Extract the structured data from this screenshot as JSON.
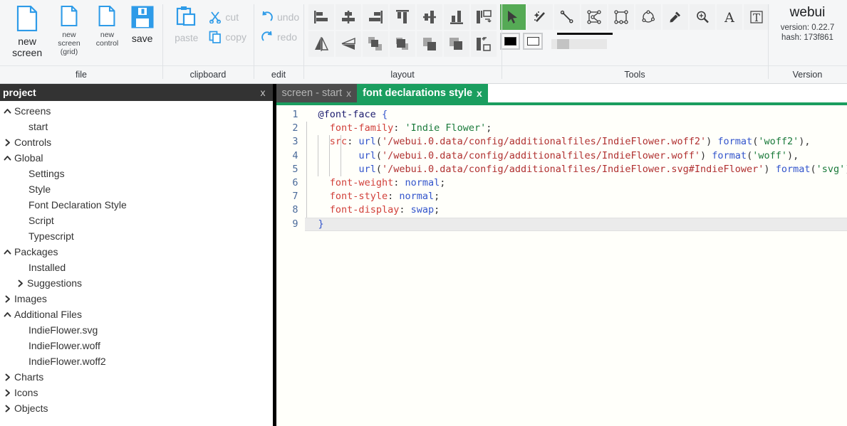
{
  "ribbon": {
    "groups": [
      {
        "label": "file",
        "items": [
          {
            "name": "new-screen",
            "label": "new screen",
            "icon": "document-icon"
          },
          {
            "name": "new-screen-grid",
            "label": "new screen\n(grid)",
            "label_line1": "new screen",
            "label_line2": "(grid)",
            "icon": "document-icon"
          },
          {
            "name": "new-control",
            "label": "new control",
            "icon": "document-icon"
          },
          {
            "name": "save",
            "label": "save",
            "icon": "floppy-disk-icon"
          }
        ]
      },
      {
        "label": "clipboard",
        "items": [
          {
            "name": "paste",
            "label": "paste",
            "icon": "clipboard-icon",
            "disabled": true
          },
          {
            "name": "cut",
            "label": "cut",
            "icon": "scissors-icon",
            "disabled": true
          },
          {
            "name": "copy",
            "label": "copy",
            "icon": "copy-icon",
            "disabled": true
          }
        ]
      },
      {
        "label": "edit",
        "items": [
          {
            "name": "undo",
            "label": "undo",
            "icon": "undo-arrow-icon",
            "disabled": true
          },
          {
            "name": "redo",
            "label": "redo",
            "icon": "redo-arrow-icon",
            "disabled": true
          }
        ]
      },
      {
        "label": "layout",
        "items": [
          {
            "name": "align-left",
            "icon": "align-left-icon"
          },
          {
            "name": "align-center-horizontal",
            "icon": "align-center-horizontal-icon"
          },
          {
            "name": "align-right",
            "icon": "align-right-icon"
          },
          {
            "name": "align-top",
            "icon": "align-top-icon"
          },
          {
            "name": "align-center-vertical",
            "icon": "align-center-vertical-icon"
          },
          {
            "name": "align-bottom",
            "icon": "align-bottom-icon"
          },
          {
            "name": "distribute-horizontal",
            "icon": "distribute-horizontal-icon"
          },
          {
            "name": "flip-horizontal",
            "icon": "flip-horizontal-icon"
          },
          {
            "name": "flip-vertical",
            "icon": "flip-vertical-icon"
          },
          {
            "name": "send-to-back",
            "icon": "send-to-back-icon"
          },
          {
            "name": "send-backward",
            "icon": "send-backward-icon"
          },
          {
            "name": "bring-forward",
            "icon": "bring-forward-icon"
          },
          {
            "name": "bring-to-front",
            "icon": "bring-to-front-icon"
          },
          {
            "name": "distribute-vertical",
            "icon": "distribute-vertical-icon"
          }
        ]
      },
      {
        "label": "Tools",
        "items": [
          {
            "name": "select-tool",
            "icon": "cursor-arrow-icon",
            "active": true
          },
          {
            "name": "magic-wand-tool",
            "icon": "magic-wand-icon"
          },
          {
            "name": "line-tool",
            "icon": "line-icon"
          },
          {
            "name": "polygon-tool",
            "icon": "polygon-icon"
          },
          {
            "name": "rectangle-tool",
            "icon": "rectangle-icon"
          },
          {
            "name": "ellipse-tool",
            "icon": "ellipse-icon"
          },
          {
            "name": "eyedropper-tool",
            "icon": "eyedropper-icon"
          },
          {
            "name": "zoom-tool",
            "icon": "magnifier-plus-icon"
          },
          {
            "name": "text-tool",
            "icon": "letter-a-icon"
          },
          {
            "name": "textbox-tool",
            "icon": "letter-t-box-icon"
          }
        ],
        "options": [
          {
            "name": "fill-color-swatch",
            "icon": "filled-square-icon",
            "color": "#000000"
          },
          {
            "name": "stroke-color-swatch",
            "icon": "outlined-square-icon",
            "color": "#ffffff"
          },
          {
            "name": "stroke-width-slider",
            "icon": "slider-icon"
          }
        ]
      },
      {
        "label": "Version",
        "app_name": "webui",
        "version_line": "version: 0.22.7",
        "hash_line": "hash: 173f861"
      }
    ]
  },
  "sidebar": {
    "header": {
      "title": "project",
      "close_label": "x"
    },
    "tree": [
      {
        "label": "Screens",
        "level": 0,
        "state": "expanded",
        "icon": "chevron-up-icon"
      },
      {
        "label": "start",
        "level": 1,
        "state": "leaf",
        "icon": ""
      },
      {
        "label": "Controls",
        "level": 0,
        "state": "collapsed",
        "icon": "chevron-right-icon"
      },
      {
        "label": "Global",
        "level": 0,
        "state": "expanded",
        "icon": "chevron-up-icon"
      },
      {
        "label": "Settings",
        "level": 1,
        "state": "leaf",
        "icon": ""
      },
      {
        "label": "Style",
        "level": 1,
        "state": "leaf",
        "icon": ""
      },
      {
        "label": "Font Declaration Style",
        "level": 1,
        "state": "leaf",
        "icon": ""
      },
      {
        "label": "Script",
        "level": 1,
        "state": "leaf",
        "icon": ""
      },
      {
        "label": "Typescript",
        "level": 1,
        "state": "leaf",
        "icon": ""
      },
      {
        "label": "Packages",
        "level": 0,
        "state": "expanded",
        "icon": "chevron-up-icon"
      },
      {
        "label": "Installed",
        "level": 1,
        "state": "leaf",
        "icon": ""
      },
      {
        "label": "Suggestions",
        "level": 1,
        "state": "collapsed",
        "icon": "chevron-right-icon"
      },
      {
        "label": "Images",
        "level": 0,
        "state": "collapsed",
        "icon": "chevron-right-icon"
      },
      {
        "label": "Additional Files",
        "level": 0,
        "state": "expanded",
        "icon": "chevron-up-icon"
      },
      {
        "label": "IndieFlower.svg",
        "level": 1,
        "state": "leaf",
        "icon": ""
      },
      {
        "label": "IndieFlower.woff",
        "level": 1,
        "state": "leaf",
        "icon": ""
      },
      {
        "label": "IndieFlower.woff2",
        "level": 1,
        "state": "leaf",
        "icon": ""
      },
      {
        "label": "Charts",
        "level": 0,
        "state": "collapsed",
        "icon": "chevron-right-icon"
      },
      {
        "label": "Icons",
        "level": 0,
        "state": "collapsed",
        "icon": "chevron-right-icon"
      },
      {
        "label": "Objects",
        "level": 0,
        "state": "collapsed",
        "icon": "chevron-right-icon"
      }
    ]
  },
  "editor": {
    "tabs": [
      {
        "label": "screen - start",
        "close_label": "x",
        "active": false
      },
      {
        "label": "font declarations style",
        "close_label": "x",
        "active": true
      }
    ],
    "active_line": 9,
    "lines": [
      {
        "n": "1",
        "tokens": [
          {
            "t": "@font-face",
            "c": "atrule"
          },
          {
            "t": " ",
            "c": "punc"
          },
          {
            "t": "{",
            "c": "brace"
          }
        ]
      },
      {
        "n": "2",
        "tokens": [
          {
            "t": "  ",
            "c": "punc"
          },
          {
            "t": "font-family",
            "c": "prop"
          },
          {
            "t": ": ",
            "c": "punc"
          },
          {
            "t": "'Indie Flower'",
            "c": "str"
          },
          {
            "t": ";",
            "c": "punc"
          }
        ]
      },
      {
        "n": "3",
        "tokens": [
          {
            "t": "  ",
            "c": "punc"
          },
          {
            "t": "src",
            "c": "prop"
          },
          {
            "t": ": ",
            "c": "punc"
          },
          {
            "t": "url",
            "c": "fn"
          },
          {
            "t": "(",
            "c": "punc"
          },
          {
            "t": "'/webui.0.data/config/additionalfiles/IndieFlower.woff2'",
            "c": "url"
          },
          {
            "t": ")",
            "c": "punc"
          },
          {
            "t": " ",
            "c": "punc"
          },
          {
            "t": "format",
            "c": "fn"
          },
          {
            "t": "(",
            "c": "punc"
          },
          {
            "t": "'woff2'",
            "c": "str"
          },
          {
            "t": ")",
            "c": "punc"
          },
          {
            "t": ",",
            "c": "punc"
          }
        ]
      },
      {
        "n": "4",
        "tokens": [
          {
            "t": "       ",
            "c": "punc"
          },
          {
            "t": "url",
            "c": "fn"
          },
          {
            "t": "(",
            "c": "punc"
          },
          {
            "t": "'/webui.0.data/config/additionalfiles/IndieFlower.woff'",
            "c": "url"
          },
          {
            "t": ")",
            "c": "punc"
          },
          {
            "t": " ",
            "c": "punc"
          },
          {
            "t": "format",
            "c": "fn"
          },
          {
            "t": "(",
            "c": "punc"
          },
          {
            "t": "'woff'",
            "c": "str"
          },
          {
            "t": ")",
            "c": "punc"
          },
          {
            "t": ",",
            "c": "punc"
          }
        ]
      },
      {
        "n": "5",
        "tokens": [
          {
            "t": "       ",
            "c": "punc"
          },
          {
            "t": "url",
            "c": "fn"
          },
          {
            "t": "(",
            "c": "punc"
          },
          {
            "t": "'/webui.0.data/config/additionalfiles/IndieFlower.svg#IndieFlower'",
            "c": "url"
          },
          {
            "t": ")",
            "c": "punc"
          },
          {
            "t": " ",
            "c": "punc"
          },
          {
            "t": "format",
            "c": "fn"
          },
          {
            "t": "(",
            "c": "punc"
          },
          {
            "t": "'svg'",
            "c": "str"
          },
          {
            "t": ")",
            "c": "punc"
          },
          {
            "t": ";",
            "c": "punc"
          }
        ]
      },
      {
        "n": "6",
        "tokens": [
          {
            "t": "  ",
            "c": "punc"
          },
          {
            "t": "font-weight",
            "c": "prop"
          },
          {
            "t": ": ",
            "c": "punc"
          },
          {
            "t": "normal",
            "c": "val"
          },
          {
            "t": ";",
            "c": "punc"
          }
        ]
      },
      {
        "n": "7",
        "tokens": [
          {
            "t": "  ",
            "c": "punc"
          },
          {
            "t": "font-style",
            "c": "prop"
          },
          {
            "t": ": ",
            "c": "punc"
          },
          {
            "t": "normal",
            "c": "val"
          },
          {
            "t": ";",
            "c": "punc"
          }
        ]
      },
      {
        "n": "8",
        "tokens": [
          {
            "t": "  ",
            "c": "punc"
          },
          {
            "t": "font-display",
            "c": "prop"
          },
          {
            "t": ": ",
            "c": "punc"
          },
          {
            "t": "swap",
            "c": "val"
          },
          {
            "t": ";",
            "c": "punc"
          }
        ]
      },
      {
        "n": "9",
        "tokens": [
          {
            "t": "}",
            "c": "brace"
          }
        ]
      }
    ]
  },
  "colors": {
    "accent_green": "#1a9e5f",
    "tool_active_green": "#55aa55",
    "icon_blue": "#2e9be8",
    "panel_header_dark": "#333333",
    "tab_inactive_dark": "#4c4c4c"
  }
}
